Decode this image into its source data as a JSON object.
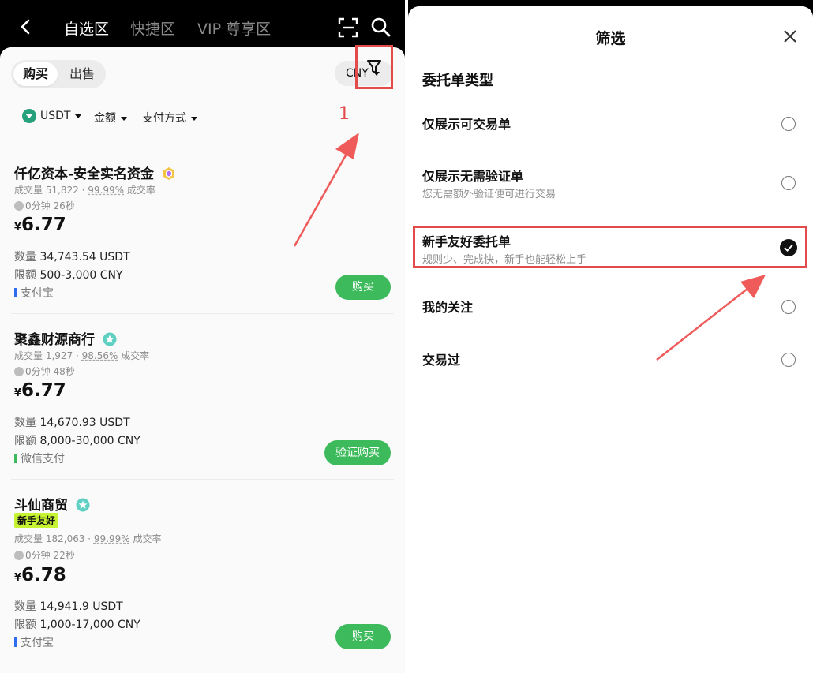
{
  "left": {
    "nav": {
      "tabs": [
        {
          "label": "自选区"
        },
        {
          "label": "快捷区"
        },
        {
          "label": "VIP 尊享区"
        }
      ]
    },
    "segment": {
      "buy": "购买",
      "sell": "出售"
    },
    "currency": "CNY",
    "filters": {
      "coin": "USDT",
      "amount": "金额",
      "payment": "支付方式"
    },
    "marker_number": "1",
    "listings": [
      {
        "merchant": "仟亿资本-安全实名资金",
        "tag": "",
        "volume_label": "成交量",
        "volume": "51,822",
        "rate": "99.99%",
        "rate_label": "成交率",
        "time": "0分钟 26秒",
        "currency_symbol": "¥",
        "price": "6.77",
        "qty_label": "数量",
        "qty": "34,743.54 USDT",
        "limit_label": "限额",
        "limit": "500-3,000 CNY",
        "payment": "支付宝",
        "payment_color": "#2f6fed",
        "button": "购买"
      },
      {
        "merchant": "聚鑫财源商行",
        "tag": "",
        "volume_label": "成交量",
        "volume": "1,927",
        "rate": "98.56%",
        "rate_label": "成交率",
        "time": "0分钟 48秒",
        "currency_symbol": "¥",
        "price": "6.77",
        "qty_label": "数量",
        "qty": "14,670.93 USDT",
        "limit_label": "限额",
        "limit": "8,000-30,000 CNY",
        "payment": "微信支付",
        "payment_color": "#3dbb5c",
        "button": "验证购买"
      },
      {
        "merchant": "斗仙商贸",
        "tag": "新手友好",
        "volume_label": "成交量",
        "volume": "182,063",
        "rate": "99.99%",
        "rate_label": "成交率",
        "time": "0分钟 22秒",
        "currency_symbol": "¥",
        "price": "6.78",
        "qty_label": "数量",
        "qty": "14,941.9 USDT",
        "limit_label": "限额",
        "limit": "1,000-17,000 CNY",
        "payment": "支付宝",
        "payment_color": "#2f6fed",
        "button": "购买"
      }
    ]
  },
  "right": {
    "title": "筛选",
    "section": "委托单类型",
    "options": [
      {
        "label": "仅展示可交易单",
        "sub": "",
        "checked": false
      },
      {
        "label": "仅展示无需验证单",
        "sub": "您无需额外验证便可进行交易",
        "checked": false
      },
      {
        "label": "新手友好委托单",
        "sub": "规则少、完成快，新手也能轻松上手",
        "checked": true
      },
      {
        "label": "我的关注",
        "sub": "",
        "checked": false
      },
      {
        "label": "交易过",
        "sub": "",
        "checked": false
      }
    ]
  },
  "colors": {
    "accent_green": "#3dbb5c",
    "annotation_red": "#e34b4b",
    "newbie_tag": "#c6f432"
  }
}
